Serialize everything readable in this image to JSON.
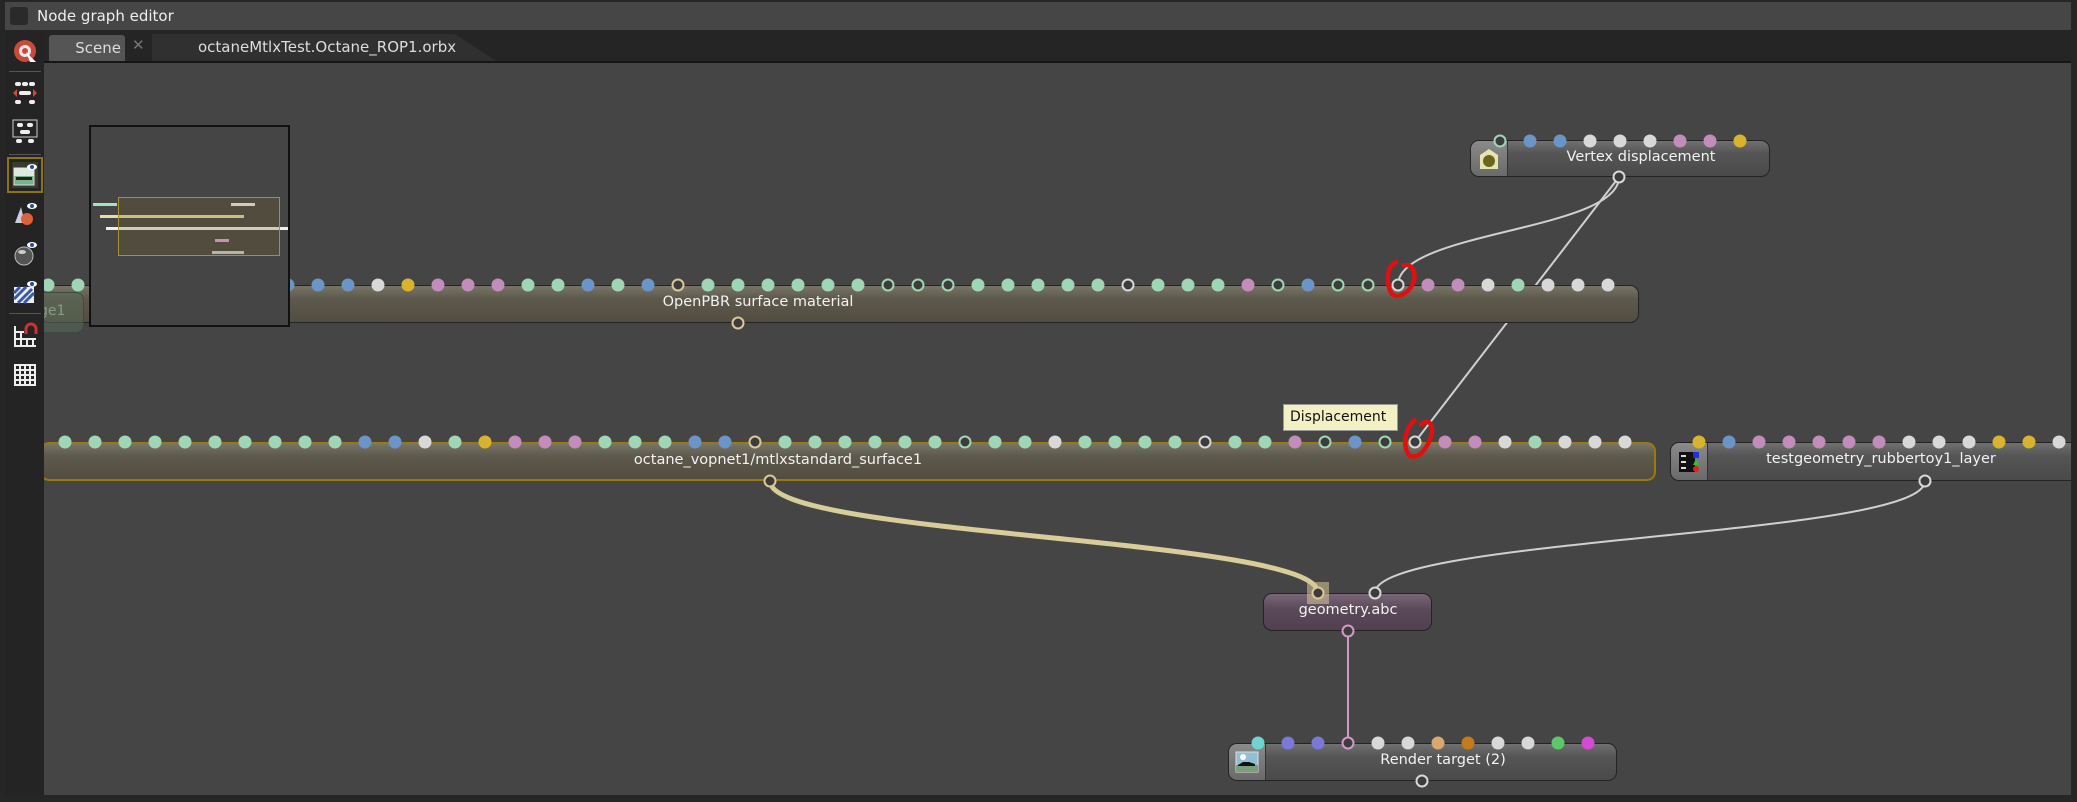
{
  "window": {
    "title": "Node graph editor"
  },
  "tabs": [
    {
      "label": "Scene"
    },
    {
      "label": "octaneMtlxTest.Octane_ROP1.orbx",
      "close_icon": "close-icon"
    }
  ],
  "toolbar": {
    "icons": [
      "unfold-cursor-icon",
      "layout-nodes-icon",
      "layout-selected-icon",
      "render-target-preview-icon",
      "material-preview-icon",
      "sphere-preview-icon",
      "texture-preview-icon",
      "snap-to-grid-icon",
      "grid-icon"
    ],
    "selected": "render-target-preview-icon"
  },
  "port_colors": {
    "g": "#9fd6b6",
    "b": "#6b95c6",
    "w": "#d8d8d8",
    "y": "#d8b42e",
    "p": "#c28dba",
    "c": "#6fd3d1",
    "v": "#7a78d8",
    "t": "#d9a870",
    "o": "#c57a1c",
    "G": "#5cc86a",
    "m": "#d44ad4",
    "hg": "#9fd6b6",
    "hw": "#d8d8d8",
    "ht": "#d8c89a",
    "hp": "#d29ac8"
  },
  "nodes": {
    "ghost": {
      "label": "ge1"
    },
    "openpbr": {
      "label": "OpenPBR surface material",
      "ports": [
        "g",
        "g",
        "g",
        "g",
        "g",
        "g",
        "g",
        "g",
        "b",
        "b",
        "b",
        "w",
        "y",
        "p",
        "p",
        "p",
        "g",
        "g",
        "b",
        "g",
        "b",
        "ht",
        "g",
        "g",
        "g",
        "g",
        "g",
        "g",
        "hg",
        "hg",
        "hg",
        "g",
        "g",
        "g",
        "g",
        "g",
        "hw",
        "g",
        "g",
        "g",
        "p",
        "hg",
        "b",
        "hg",
        "hg",
        "hw",
        "p",
        "p",
        "w",
        "g",
        "w",
        "w",
        "w"
      ],
      "output": "ht"
    },
    "mtlx": {
      "label": "octane_vopnet1/mtlxstandard_surface1",
      "ports": [
        "g",
        "g",
        "g",
        "g",
        "g",
        "g",
        "g",
        "g",
        "g",
        "g",
        "b",
        "b",
        "w",
        "g",
        "y",
        "p",
        "p",
        "p",
        "g",
        "g",
        "g",
        "b",
        "b",
        "ht",
        "g",
        "g",
        "g",
        "g",
        "g",
        "g",
        "hg",
        "g",
        "g",
        "w",
        "g",
        "g",
        "g",
        "g",
        "hw",
        "g",
        "g",
        "p",
        "hg",
        "b",
        "hg",
        "hw",
        "p",
        "p",
        "w",
        "g",
        "w",
        "w",
        "w"
      ],
      "output": "ht",
      "selected": true
    },
    "vertex": {
      "label": "Vertex displacement",
      "icon": "displacement-icon",
      "ports": [
        "hg",
        "b",
        "b",
        "w",
        "w",
        "w",
        "p",
        "p",
        "y"
      ],
      "output": "hw"
    },
    "testgeom": {
      "label": "testgeometry_rubbertoy1_layer",
      "icon": "geometry-layer-icon",
      "ports": [
        "y",
        "b",
        "p",
        "p",
        "p",
        "p",
        "p",
        "w",
        "w",
        "w",
        "y",
        "y",
        "w"
      ],
      "output": "hw"
    },
    "geometry": {
      "label": "geometry.abc",
      "inputs": [
        "ht",
        "hw"
      ],
      "output": "hp"
    },
    "render": {
      "label": "Render target (2)",
      "icon": "render-target-icon",
      "ports": [
        "c",
        "v",
        "v",
        "hp",
        "w",
        "w",
        "t",
        "o",
        "w",
        "w",
        "G",
        "m"
      ],
      "output": "hw"
    }
  },
  "tooltip": {
    "text": "Displacement"
  },
  "annotations": {
    "color": "#e01010",
    "marks": [
      "openpbr-displacement-port",
      "mtlx-displacement-port"
    ]
  },
  "wire_colors": {
    "default": "#d0d0d0",
    "material": "#d8cc98",
    "geometry": "#d29ac8"
  }
}
